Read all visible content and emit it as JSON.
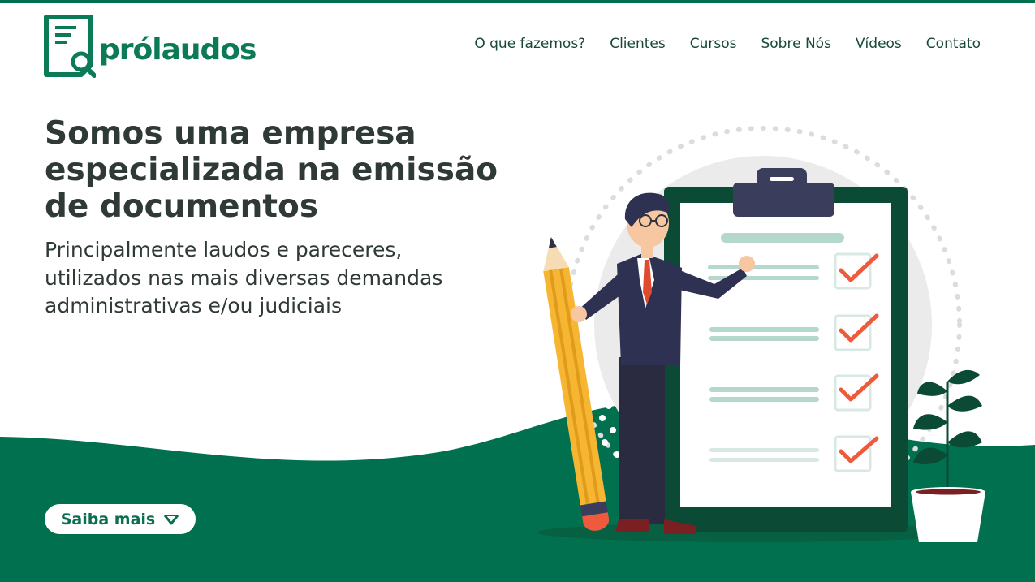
{
  "brand": {
    "name": "prólaudos",
    "logo_icon": "document-magnifier-icon"
  },
  "nav": {
    "items": [
      {
        "label": "O que fazemos?"
      },
      {
        "label": "Clientes"
      },
      {
        "label": "Cursos"
      },
      {
        "label": "Sobre Nós"
      },
      {
        "label": "Vídeos"
      },
      {
        "label": "Contato"
      }
    ]
  },
  "hero": {
    "title_lines": [
      "Somos uma empresa",
      "especializada na emissão",
      "de documentos"
    ],
    "subtitle_lines": [
      "Principalmente laudos e pareceres,",
      "utilizados nas mais diversas demandas",
      "administrativas e/ou judiciais"
    ],
    "cta_label": "Saiba mais",
    "cta_icon": "chevron-down-icon"
  },
  "illustration": {
    "subject": "businessman-with-pencil-and-checklist",
    "checklist_items": 4
  },
  "colors": {
    "brand_green": "#00704f",
    "dark_green": "#0b5a3f",
    "text_dark": "#2f3a37",
    "check_red": "#ef5a3c",
    "pencil_yellow": "#f7b632"
  }
}
